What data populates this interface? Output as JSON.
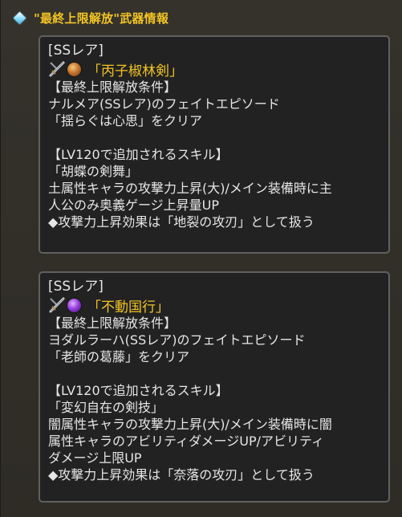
{
  "section": {
    "title": "\"最終上限解放\"武器情報"
  },
  "weapons": [
    {
      "rarity": "[SSレア]",
      "element_icon": "earth-element-icon",
      "name": "「丙子椒林剣」",
      "lines_condition": [
        "【最終上限解放条件】",
        "ナルメア(SSレア)のフェイトエピソード",
        "「揺らぐは心思」をクリア"
      ],
      "lines_skill": [
        "【LV120で追加されるスキル】",
        "「胡蝶の剣舞」",
        "土属性キャラの攻撃力上昇(大)/メイン装備時に主",
        "人公のみ奥義ゲージ上昇量UP",
        "◆攻撃力上昇効果は「地裂の攻刃」として扱う"
      ]
    },
    {
      "rarity": "[SSレア]",
      "element_icon": "dark-element-icon",
      "name": "「不動国行」",
      "lines_condition": [
        "【最終上限解放条件】",
        "ヨダルラーハ(SSレア)のフェイトエピソード",
        "「老師の葛藤」をクリア"
      ],
      "lines_skill": [
        "【LV120で追加されるスキル】",
        "「変幻自在の剣技」",
        "闇属性キャラの攻撃力上昇(大)/メイン装備時に闇",
        "属性キャラのアビリティダメージUP/アビリティ",
        "ダメージ上限UP",
        "◆攻撃力上昇効果は「奈落の攻刃」として扱う"
      ]
    }
  ],
  "colors": {
    "accent": "#f2c425",
    "background": "#2f2d26",
    "card_background": "#222222",
    "card_border": "#606060",
    "text": "#e6e6e6"
  }
}
